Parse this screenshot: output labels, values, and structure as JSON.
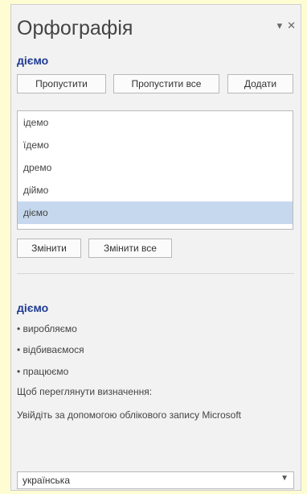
{
  "pane": {
    "title": "Орфографія",
    "pin_glyph": "▾",
    "close_glyph": "✕"
  },
  "misspelled_word": "діємо",
  "buttons": {
    "ignore": "Пропустити",
    "ignore_all": "Пропустити все",
    "add": "Додати",
    "change": "Змінити",
    "change_all": "Змінити все"
  },
  "suggestions": [
    {
      "text": "ідемо",
      "selected": false
    },
    {
      "text": "їдемо",
      "selected": false
    },
    {
      "text": "дремо",
      "selected": false
    },
    {
      "text": "діймо",
      "selected": false
    },
    {
      "text": "діємо",
      "selected": true
    }
  ],
  "definition": {
    "word": "діємо",
    "synonyms": [
      "• виробляємо",
      "• відбиваємося",
      "• працюємо"
    ],
    "prompt": "Щоб переглянути визначення:",
    "signin": "Увійдіть за допомогою облікового запису Microsoft"
  },
  "language": {
    "selected": "українська"
  },
  "colors": {
    "page_background": "#fdfcd3",
    "pane_background": "#f2f2f2",
    "accent_word": "#1f3a93",
    "selection": "#c6d8ee"
  }
}
